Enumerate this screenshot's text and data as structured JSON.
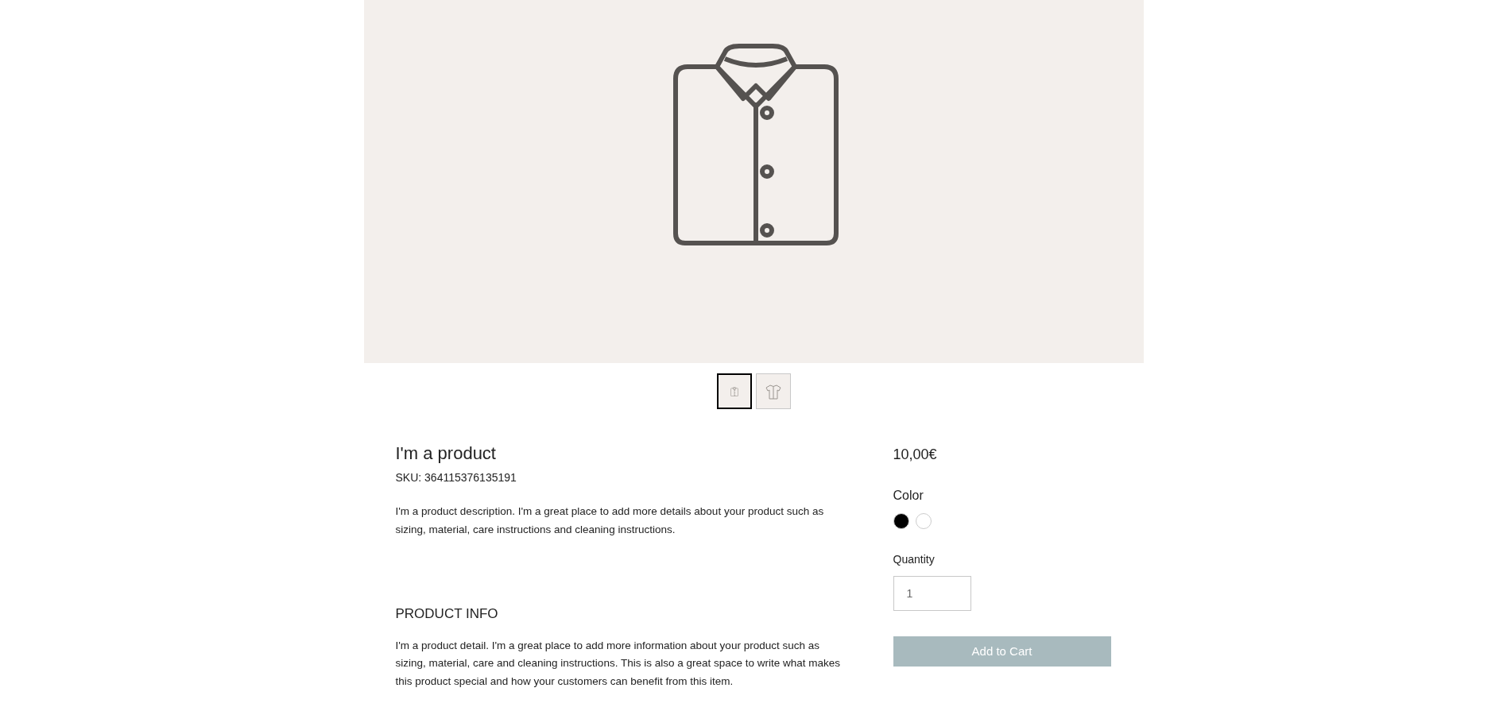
{
  "gallery": {
    "thumbnails": [
      {
        "kind": "folded-shirt",
        "selected": true
      },
      {
        "kind": "tshirt",
        "selected": false
      }
    ]
  },
  "product": {
    "title": "I'm a product",
    "sku": "SKU: 364115376135191",
    "description": "I'm a product description. I'm a great place to add more details about your product such as sizing, material, care instructions and cleaning instructions."
  },
  "info": {
    "heading": "PRODUCT INFO",
    "text": "I'm a product detail. I'm a great place to add more information about your product such as sizing, material, care and cleaning instructions. This is also a great space to write what makes this product special and how your customers can benefit from this item."
  },
  "purchase": {
    "price": "10,00€",
    "color_label": "Color",
    "colors": [
      {
        "color": "#000000"
      },
      {
        "color": "#ffffff"
      }
    ],
    "quantity_label": "Quantity",
    "quantity": "1",
    "button": "Add to Cart"
  }
}
